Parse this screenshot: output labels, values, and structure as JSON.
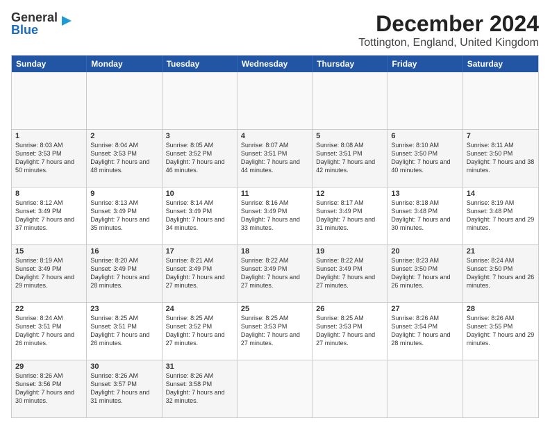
{
  "header": {
    "logo_line1": "General",
    "logo_line2": "Blue",
    "title": "December 2024",
    "subtitle": "Tottington, England, United Kingdom"
  },
  "calendar": {
    "days": [
      "Sunday",
      "Monday",
      "Tuesday",
      "Wednesday",
      "Thursday",
      "Friday",
      "Saturday"
    ],
    "weeks": [
      [
        {
          "day": null,
          "content": ""
        },
        {
          "day": null,
          "content": ""
        },
        {
          "day": null,
          "content": ""
        },
        {
          "day": null,
          "content": ""
        },
        {
          "day": null,
          "content": ""
        },
        {
          "day": null,
          "content": ""
        },
        {
          "day": null,
          "content": ""
        }
      ],
      [
        {
          "day": "1",
          "sunrise": "Sunrise: 8:03 AM",
          "sunset": "Sunset: 3:53 PM",
          "daylight": "Daylight: 7 hours and 50 minutes."
        },
        {
          "day": "2",
          "sunrise": "Sunrise: 8:04 AM",
          "sunset": "Sunset: 3:53 PM",
          "daylight": "Daylight: 7 hours and 48 minutes."
        },
        {
          "day": "3",
          "sunrise": "Sunrise: 8:05 AM",
          "sunset": "Sunset: 3:52 PM",
          "daylight": "Daylight: 7 hours and 46 minutes."
        },
        {
          "day": "4",
          "sunrise": "Sunrise: 8:07 AM",
          "sunset": "Sunset: 3:51 PM",
          "daylight": "Daylight: 7 hours and 44 minutes."
        },
        {
          "day": "5",
          "sunrise": "Sunrise: 8:08 AM",
          "sunset": "Sunset: 3:51 PM",
          "daylight": "Daylight: 7 hours and 42 minutes."
        },
        {
          "day": "6",
          "sunrise": "Sunrise: 8:10 AM",
          "sunset": "Sunset: 3:50 PM",
          "daylight": "Daylight: 7 hours and 40 minutes."
        },
        {
          "day": "7",
          "sunrise": "Sunrise: 8:11 AM",
          "sunset": "Sunset: 3:50 PM",
          "daylight": "Daylight: 7 hours and 38 minutes."
        }
      ],
      [
        {
          "day": "8",
          "sunrise": "Sunrise: 8:12 AM",
          "sunset": "Sunset: 3:49 PM",
          "daylight": "Daylight: 7 hours and 37 minutes."
        },
        {
          "day": "9",
          "sunrise": "Sunrise: 8:13 AM",
          "sunset": "Sunset: 3:49 PM",
          "daylight": "Daylight: 7 hours and 35 minutes."
        },
        {
          "day": "10",
          "sunrise": "Sunrise: 8:14 AM",
          "sunset": "Sunset: 3:49 PM",
          "daylight": "Daylight: 7 hours and 34 minutes."
        },
        {
          "day": "11",
          "sunrise": "Sunrise: 8:16 AM",
          "sunset": "Sunset: 3:49 PM",
          "daylight": "Daylight: 7 hours and 33 minutes."
        },
        {
          "day": "12",
          "sunrise": "Sunrise: 8:17 AM",
          "sunset": "Sunset: 3:49 PM",
          "daylight": "Daylight: 7 hours and 31 minutes."
        },
        {
          "day": "13",
          "sunrise": "Sunrise: 8:18 AM",
          "sunset": "Sunset: 3:48 PM",
          "daylight": "Daylight: 7 hours and 30 minutes."
        },
        {
          "day": "14",
          "sunrise": "Sunrise: 8:19 AM",
          "sunset": "Sunset: 3:48 PM",
          "daylight": "Daylight: 7 hours and 29 minutes."
        }
      ],
      [
        {
          "day": "15",
          "sunrise": "Sunrise: 8:19 AM",
          "sunset": "Sunset: 3:49 PM",
          "daylight": "Daylight: 7 hours and 29 minutes."
        },
        {
          "day": "16",
          "sunrise": "Sunrise: 8:20 AM",
          "sunset": "Sunset: 3:49 PM",
          "daylight": "Daylight: 7 hours and 28 minutes."
        },
        {
          "day": "17",
          "sunrise": "Sunrise: 8:21 AM",
          "sunset": "Sunset: 3:49 PM",
          "daylight": "Daylight: 7 hours and 27 minutes."
        },
        {
          "day": "18",
          "sunrise": "Sunrise: 8:22 AM",
          "sunset": "Sunset: 3:49 PM",
          "daylight": "Daylight: 7 hours and 27 minutes."
        },
        {
          "day": "19",
          "sunrise": "Sunrise: 8:22 AM",
          "sunset": "Sunset: 3:49 PM",
          "daylight": "Daylight: 7 hours and 27 minutes."
        },
        {
          "day": "20",
          "sunrise": "Sunrise: 8:23 AM",
          "sunset": "Sunset: 3:50 PM",
          "daylight": "Daylight: 7 hours and 26 minutes."
        },
        {
          "day": "21",
          "sunrise": "Sunrise: 8:24 AM",
          "sunset": "Sunset: 3:50 PM",
          "daylight": "Daylight: 7 hours and 26 minutes."
        }
      ],
      [
        {
          "day": "22",
          "sunrise": "Sunrise: 8:24 AM",
          "sunset": "Sunset: 3:51 PM",
          "daylight": "Daylight: 7 hours and 26 minutes."
        },
        {
          "day": "23",
          "sunrise": "Sunrise: 8:25 AM",
          "sunset": "Sunset: 3:51 PM",
          "daylight": "Daylight: 7 hours and 26 minutes."
        },
        {
          "day": "24",
          "sunrise": "Sunrise: 8:25 AM",
          "sunset": "Sunset: 3:52 PM",
          "daylight": "Daylight: 7 hours and 27 minutes."
        },
        {
          "day": "25",
          "sunrise": "Sunrise: 8:25 AM",
          "sunset": "Sunset: 3:53 PM",
          "daylight": "Daylight: 7 hours and 27 minutes."
        },
        {
          "day": "26",
          "sunrise": "Sunrise: 8:25 AM",
          "sunset": "Sunset: 3:53 PM",
          "daylight": "Daylight: 7 hours and 27 minutes."
        },
        {
          "day": "27",
          "sunrise": "Sunrise: 8:26 AM",
          "sunset": "Sunset: 3:54 PM",
          "daylight": "Daylight: 7 hours and 28 minutes."
        },
        {
          "day": "28",
          "sunrise": "Sunrise: 8:26 AM",
          "sunset": "Sunset: 3:55 PM",
          "daylight": "Daylight: 7 hours and 29 minutes."
        }
      ],
      [
        {
          "day": "29",
          "sunrise": "Sunrise: 8:26 AM",
          "sunset": "Sunset: 3:56 PM",
          "daylight": "Daylight: 7 hours and 30 minutes."
        },
        {
          "day": "30",
          "sunrise": "Sunrise: 8:26 AM",
          "sunset": "Sunset: 3:57 PM",
          "daylight": "Daylight: 7 hours and 31 minutes."
        },
        {
          "day": "31",
          "sunrise": "Sunrise: 8:26 AM",
          "sunset": "Sunset: 3:58 PM",
          "daylight": "Daylight: 7 hours and 32 minutes."
        },
        {
          "day": null,
          "content": ""
        },
        {
          "day": null,
          "content": ""
        },
        {
          "day": null,
          "content": ""
        },
        {
          "day": null,
          "content": ""
        }
      ]
    ]
  }
}
